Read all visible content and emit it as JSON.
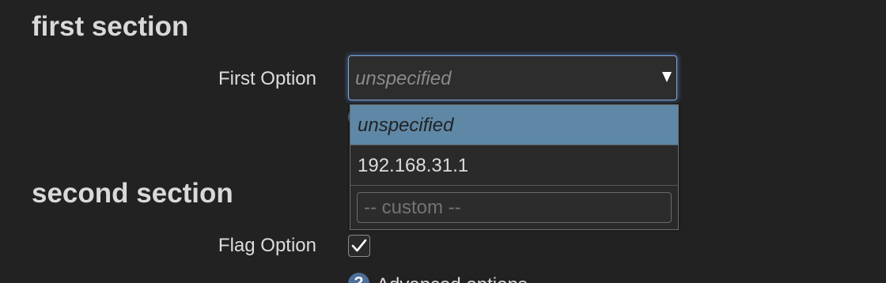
{
  "sections": {
    "first": {
      "title": "first section",
      "option_label": "First Option",
      "select": {
        "value": "unspecified",
        "options": [
          "unspecified",
          "192.168.31.1"
        ],
        "custom_placeholder": "-- custom --"
      }
    },
    "second": {
      "title": "second section",
      "flag_label": "Flag Option",
      "flag_checked": true,
      "help_glyph": "?",
      "advanced_text": "Advanced options"
    }
  },
  "colors": {
    "background": "#222222",
    "selected_option": "#5f88a6",
    "focus_border": "#7fa8d9",
    "help_icon": "#4c6f97"
  },
  "icons": {
    "dropdown_arrow": "chevron-down-icon",
    "checkbox_tick": "check-icon",
    "help": "help-icon"
  }
}
